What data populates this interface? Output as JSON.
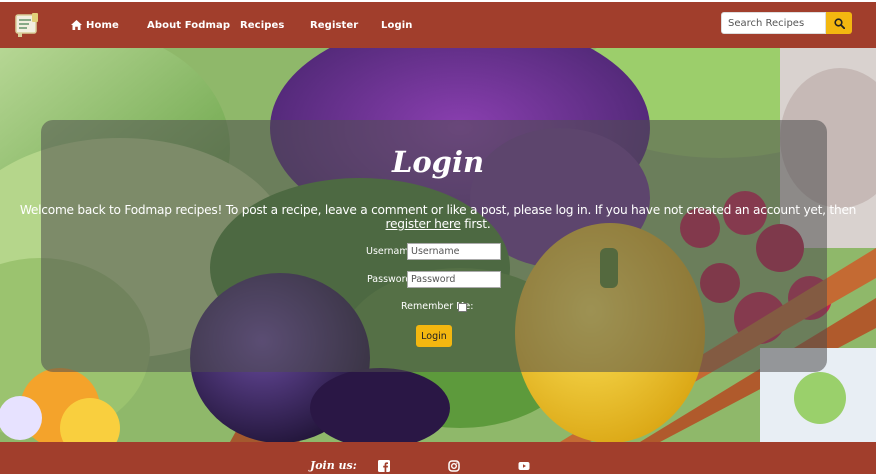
{
  "nav": {
    "logo_icon": "recipe-board-icon",
    "items": [
      {
        "label": "Home",
        "icon": "home-icon"
      },
      {
        "label": "About Fodmap"
      },
      {
        "label": "Recipes"
      },
      {
        "label": "Register"
      },
      {
        "label": "Login"
      }
    ],
    "search": {
      "placeholder": "Search Recipes",
      "button_icon": "search-icon"
    }
  },
  "login": {
    "title": "Login",
    "welcome_before": "Welcome back to Fodmap recipes! To post a recipe, leave a comment or like a post, please log in. If you have not created an account yet, then ",
    "welcome_link": "register here",
    "welcome_after": " first.",
    "username_label": "Username:",
    "username_placeholder": "Username",
    "password_label": "Password:",
    "password_placeholder": "Password",
    "remember_label": "Remember Me:",
    "submit_label": "Login"
  },
  "footer": {
    "join_label": "Join us:",
    "social": [
      "facebook-icon",
      "instagram-icon",
      "youtube-icon"
    ]
  },
  "colors": {
    "brand": "#a13e2c",
    "accent": "#f3b710"
  }
}
